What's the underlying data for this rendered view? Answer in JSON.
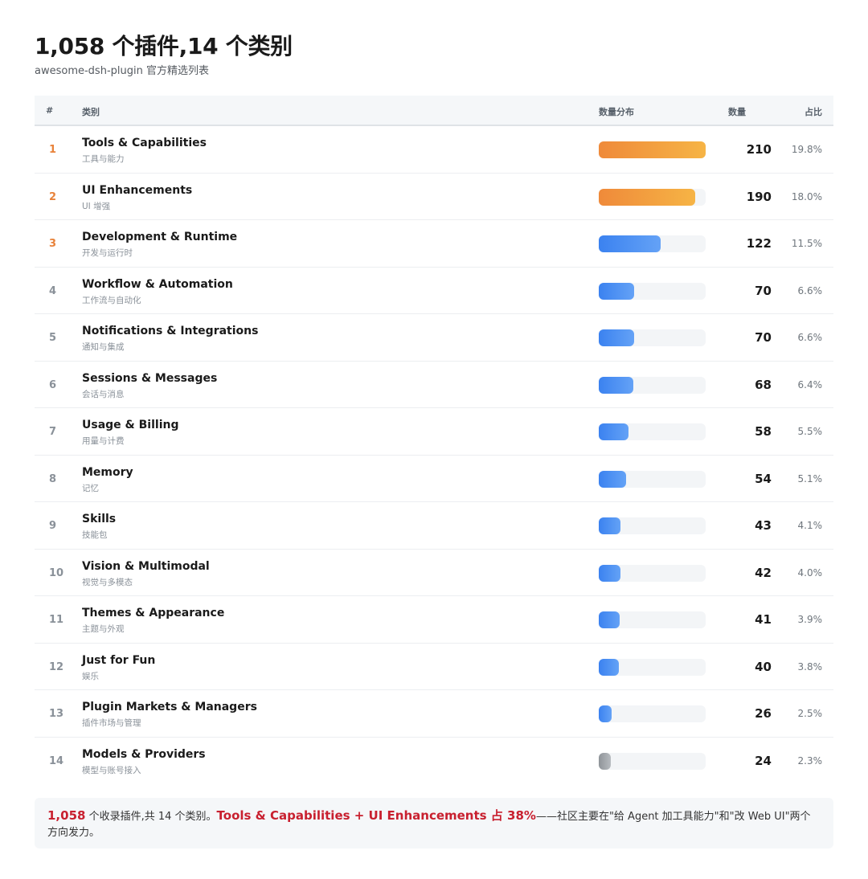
{
  "header": {
    "title": "1,058 个插件,14 个类别",
    "subtitle": "awesome-dsh-plugin 官方精选列表"
  },
  "table": {
    "columns": [
      "#",
      "类别",
      "数量分布",
      "数量",
      "占比"
    ]
  },
  "chart_data": {
    "type": "bar",
    "categories": [
      "Tools & Capabilities",
      "UI Enhancements",
      "Development & Runtime",
      "Workflow & Automation",
      "Notifications & Integrations",
      "Sessions & Messages",
      "Usage & Billing",
      "Memory",
      "Skills",
      "Vision & Multimodal",
      "Themes & Appearance",
      "Just for Fun",
      "Plugin Markets & Managers",
      "Models & Providers"
    ],
    "values": [
      210,
      190,
      122,
      70,
      70,
      68,
      58,
      54,
      43,
      42,
      41,
      40,
      26,
      24
    ],
    "xlim": [
      0,
      210
    ],
    "rows": [
      {
        "rank": "1",
        "name": "Tools & Capabilities",
        "sub": "工具与能力",
        "count": "210",
        "pct": "19.8%",
        "value": 210,
        "color": "orange"
      },
      {
        "rank": "2",
        "name": "UI Enhancements",
        "sub": "UI 增强",
        "count": "190",
        "pct": "18.0%",
        "value": 190,
        "color": "orange"
      },
      {
        "rank": "3",
        "name": "Development & Runtime",
        "sub": "开发与运行时",
        "count": "122",
        "pct": "11.5%",
        "value": 122,
        "color": "blue"
      },
      {
        "rank": "4",
        "name": "Workflow & Automation",
        "sub": "工作流与自动化",
        "count": "70",
        "pct": "6.6%",
        "value": 70,
        "color": "blue"
      },
      {
        "rank": "5",
        "name": "Notifications & Integrations",
        "sub": "通知与集成",
        "count": "70",
        "pct": "6.6%",
        "value": 70,
        "color": "blue"
      },
      {
        "rank": "6",
        "name": "Sessions & Messages",
        "sub": "会话与消息",
        "count": "68",
        "pct": "6.4%",
        "value": 68,
        "color": "blue"
      },
      {
        "rank": "7",
        "name": "Usage & Billing",
        "sub": "用量与计费",
        "count": "58",
        "pct": "5.5%",
        "value": 58,
        "color": "blue"
      },
      {
        "rank": "8",
        "name": "Memory",
        "sub": "记忆",
        "count": "54",
        "pct": "5.1%",
        "value": 54,
        "color": "blue"
      },
      {
        "rank": "9",
        "name": "Skills",
        "sub": "技能包",
        "count": "43",
        "pct": "4.1%",
        "value": 43,
        "color": "blue"
      },
      {
        "rank": "10",
        "name": "Vision & Multimodal",
        "sub": "视觉与多模态",
        "count": "42",
        "pct": "4.0%",
        "value": 42,
        "color": "blue"
      },
      {
        "rank": "11",
        "name": "Themes & Appearance",
        "sub": "主题与外观",
        "count": "41",
        "pct": "3.9%",
        "value": 41,
        "color": "blue"
      },
      {
        "rank": "12",
        "name": "Just for Fun",
        "sub": "娱乐",
        "count": "40",
        "pct": "3.8%",
        "value": 40,
        "color": "blue"
      },
      {
        "rank": "13",
        "name": "Plugin Markets & Managers",
        "sub": "插件市场与管理",
        "count": "26",
        "pct": "2.5%",
        "value": 26,
        "color": "blue"
      },
      {
        "rank": "14",
        "name": "Models & Providers",
        "sub": "模型与账号接入",
        "count": "24",
        "pct": "2.3%",
        "value": 24,
        "color": "gray"
      }
    ]
  },
  "note": {
    "total": "1,058",
    "text1": " 个收录插件,共 14 个类别。",
    "highlight": "Tools & Capabilities + UI Enhancements 占 38%",
    "text2": "——社区主要在\"给 Agent 加工具能力\"和\"改 Web UI\"两个方向发力。"
  },
  "colors": {
    "orange": "#ef8a3a",
    "blue": "#3b82f0",
    "gray": "#8f9499",
    "highlight": "#c8202f"
  }
}
